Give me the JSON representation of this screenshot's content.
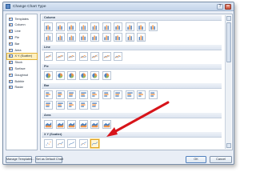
{
  "window": {
    "title": "Change Chart Type"
  },
  "sidebar": {
    "items": [
      {
        "label": "Templates",
        "icon": "folder-icon"
      },
      {
        "label": "Column",
        "icon": "column-chart-icon"
      },
      {
        "label": "Line",
        "icon": "line-chart-icon"
      },
      {
        "label": "Pie",
        "icon": "pie-chart-icon"
      },
      {
        "label": "Bar",
        "icon": "bar-chart-icon"
      },
      {
        "label": "Area",
        "icon": "area-chart-icon"
      },
      {
        "label": "X Y (Scatter)",
        "icon": "scatter-chart-icon",
        "selected": true
      },
      {
        "label": "Stock",
        "icon": "stock-chart-icon"
      },
      {
        "label": "Surface",
        "icon": "surface-chart-icon"
      },
      {
        "label": "Doughnut",
        "icon": "doughnut-chart-icon"
      },
      {
        "label": "Bubble",
        "icon": "bubble-chart-icon"
      },
      {
        "label": "Radar",
        "icon": "radar-chart-icon"
      }
    ]
  },
  "sections": [
    {
      "label": "Column",
      "thumb_style": "column",
      "count": 19
    },
    {
      "label": "Line",
      "thumb_style": "line",
      "count": 7
    },
    {
      "label": "Pie",
      "thumb_style": "pie",
      "count": 6
    },
    {
      "label": "Bar",
      "thumb_style": "bar",
      "count": 15
    },
    {
      "label": "Area",
      "thumb_style": "area",
      "count": 6
    },
    {
      "label": "X Y (Scatter)",
      "thumb_style": "scatter",
      "count": 5,
      "selected_index": 4
    }
  ],
  "buttons": {
    "manage_templates": "Manage Templates...",
    "set_default": "Set as Default Chart",
    "ok": "OK",
    "cancel": "Cancel"
  },
  "colors": {
    "accent_blue": "#4f81bd",
    "accent_orange": "#f79646",
    "selection": "#e0a426",
    "arrow": "#d7141a"
  }
}
